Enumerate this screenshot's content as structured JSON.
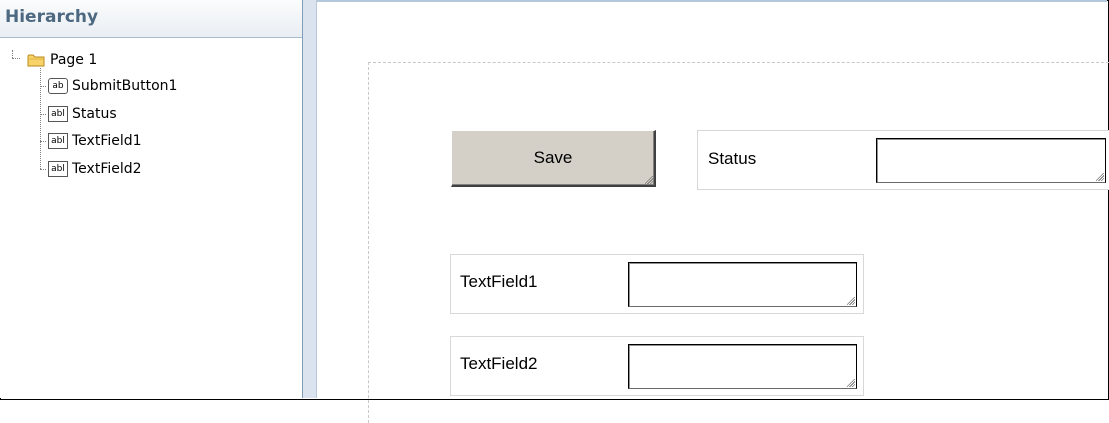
{
  "hierarchy": {
    "title": "Hierarchy",
    "root": {
      "label": "Page 1",
      "icon": "folder-icon"
    },
    "children": [
      {
        "label": "SubmitButton1",
        "icon": "ab",
        "icon_name": "button-control-icon"
      },
      {
        "label": "Status",
        "icon": "abl",
        "icon_name": "textfield-control-icon"
      },
      {
        "label": "TextField1",
        "icon": "abl",
        "icon_name": "textfield-control-icon"
      },
      {
        "label": "TextField2",
        "icon": "abl",
        "icon_name": "textfield-control-icon"
      }
    ]
  },
  "canvas": {
    "save_button": {
      "label": "Save"
    },
    "status_field": {
      "label": "Status",
      "value": ""
    },
    "textfield1": {
      "label": "TextField1",
      "value": ""
    },
    "textfield2": {
      "label": "TextField2",
      "value": ""
    }
  },
  "colors": {
    "header_text": "#4d6981",
    "panel_border": "#7f9db9",
    "button_face": "#d4d0c8",
    "separator": "#dbe4ee"
  }
}
